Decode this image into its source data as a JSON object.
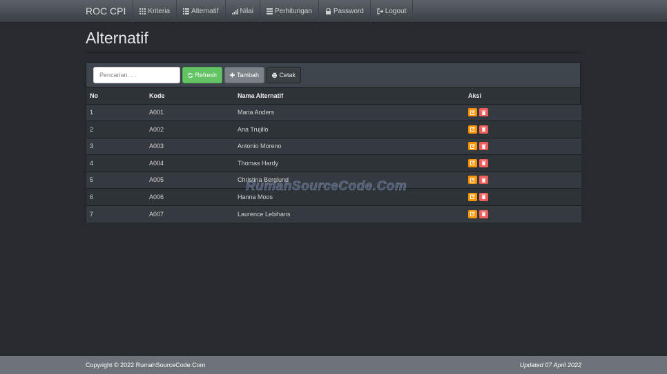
{
  "navbar": {
    "brand": "ROC CPI",
    "items": [
      {
        "label": "Kriteria",
        "icon": "grid-icon"
      },
      {
        "label": "Alternatif",
        "icon": "list-icon"
      },
      {
        "label": "Nilai",
        "icon": "signal-icon"
      },
      {
        "label": "Perhitungan",
        "icon": "table-icon"
      },
      {
        "label": "Password",
        "icon": "lock-icon"
      },
      {
        "label": "Logout",
        "icon": "logout-icon"
      }
    ]
  },
  "page": {
    "title": "Alternatif"
  },
  "toolbar": {
    "search_placeholder": "Pencarian. . .",
    "refresh_label": "Refresh",
    "tambah_label": "Tambah",
    "cetak_label": "Cetak"
  },
  "table": {
    "headers": [
      "No",
      "Kode",
      "Nama Alternatif",
      "Aksi"
    ],
    "rows": [
      {
        "no": "1",
        "kode": "A001",
        "nama": "Maria Anders"
      },
      {
        "no": "2",
        "kode": "A002",
        "nama": "Ana Trujillo"
      },
      {
        "no": "3",
        "kode": "A003",
        "nama": "Antonio Moreno"
      },
      {
        "no": "4",
        "kode": "A004",
        "nama": "Thomas Hardy"
      },
      {
        "no": "5",
        "kode": "A005",
        "nama": "Christina Berglund"
      },
      {
        "no": "6",
        "kode": "A006",
        "nama": "Hanna Moos"
      },
      {
        "no": "7",
        "kode": "A007",
        "nama": "Laurence Lebihans"
      }
    ]
  },
  "watermark": "RumahSourceCode.Com",
  "footer": {
    "copyright": "Copyright © 2022 RumahSourceCode.Com",
    "updated": "Updated 07 April 2022"
  },
  "colors": {
    "background": "#272b30",
    "refresh": "#62c462",
    "edit": "#f89406",
    "delete": "#ee5f5b"
  }
}
